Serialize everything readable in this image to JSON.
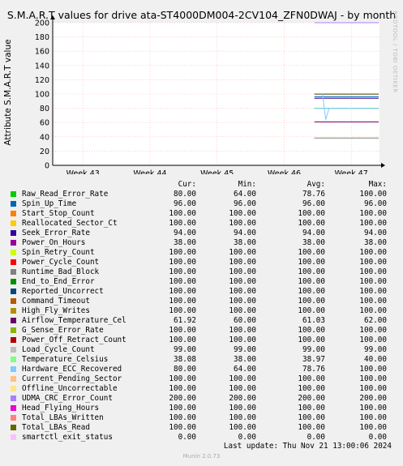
{
  "title": "S.M.A.R.T values for drive ata-ST4000DM004-2CV104_ZFN0DWAJ - by month",
  "watermark": "RRDTOOL / TOBI OETIKER",
  "footer": "Munin 2.0.73",
  "last_update": "Last update: Thu Nov 21 13:00:06 2024",
  "legend_header": {
    "cur": "Cur:",
    "min": "Min:",
    "avg": "Avg:",
    "max": "Max:"
  },
  "chart_data": {
    "type": "line",
    "title": "S.M.A.R.T values for drive ata-ST4000DM004-2CV104_ZFN0DWAJ - by month",
    "ylabel": "Attribute S.M.A.R.T value",
    "xlabel": "",
    "x_ticks": [
      "Week 43",
      "Week 44",
      "Week 45",
      "Week 46",
      "Week 47"
    ],
    "y_ticks": [
      0,
      20,
      40,
      60,
      80,
      100,
      120,
      140,
      160,
      180,
      200
    ],
    "ylim": [
      0,
      200
    ],
    "grid": true,
    "data_start_week": 46.45,
    "series": [
      {
        "name": "Raw_Read_Error_Rate",
        "color": "#00cc00",
        "cur": "80.00",
        "min": "64.00",
        "avg": "78.76",
        "max": "100.00",
        "line": 80
      },
      {
        "name": "Spin_Up_Time",
        "color": "#0066b3",
        "cur": "96.00",
        "min": "96.00",
        "avg": "96.00",
        "max": "96.00",
        "line": 96
      },
      {
        "name": "Start_Stop_Count",
        "color": "#ff8000",
        "cur": "100.00",
        "min": "100.00",
        "avg": "100.00",
        "max": "100.00",
        "line": 100
      },
      {
        "name": "Reallocated_Sector_Ct",
        "color": "#ffcc00",
        "cur": "100.00",
        "min": "100.00",
        "avg": "100.00",
        "max": "100.00",
        "line": 100
      },
      {
        "name": "Seek_Error_Rate",
        "color": "#330099",
        "cur": "94.00",
        "min": "94.00",
        "avg": "94.00",
        "max": "94.00",
        "line": 94
      },
      {
        "name": "Power_On_Hours",
        "color": "#990099",
        "cur": "38.00",
        "min": "38.00",
        "avg": "38.00",
        "max": "38.00",
        "line": 38
      },
      {
        "name": "Spin_Retry_Count",
        "color": "#ccff00",
        "cur": "100.00",
        "min": "100.00",
        "avg": "100.00",
        "max": "100.00",
        "line": 100
      },
      {
        "name": "Power_Cycle_Count",
        "color": "#ff0000",
        "cur": "100.00",
        "min": "100.00",
        "avg": "100.00",
        "max": "100.00",
        "line": 100
      },
      {
        "name": "Runtime_Bad_Block",
        "color": "#808080",
        "cur": "100.00",
        "min": "100.00",
        "avg": "100.00",
        "max": "100.00",
        "line": 100
      },
      {
        "name": "End_to_End_Error",
        "color": "#008f00",
        "cur": "100.00",
        "min": "100.00",
        "avg": "100.00",
        "max": "100.00",
        "line": 100
      },
      {
        "name": "Reported_Uncorrect",
        "color": "#00487d",
        "cur": "100.00",
        "min": "100.00",
        "avg": "100.00",
        "max": "100.00",
        "line": 100
      },
      {
        "name": "Command_Timeout",
        "color": "#b35a00",
        "cur": "100.00",
        "min": "100.00",
        "avg": "100.00",
        "max": "100.00",
        "line": 100
      },
      {
        "name": "High_Fly_Writes",
        "color": "#b38f00",
        "cur": "100.00",
        "min": "100.00",
        "avg": "100.00",
        "max": "100.00",
        "line": 100
      },
      {
        "name": "Airflow_Temperature_Cel",
        "color": "#6b006b",
        "cur": "61.92",
        "min": "60.00",
        "avg": "61.03",
        "max": "62.00",
        "line": 61
      },
      {
        "name": "G_Sense_Error_Rate",
        "color": "#8fb300",
        "cur": "100.00",
        "min": "100.00",
        "avg": "100.00",
        "max": "100.00",
        "line": 100
      },
      {
        "name": "Power_Off_Retract_Count",
        "color": "#b30000",
        "cur": "100.00",
        "min": "100.00",
        "avg": "100.00",
        "max": "100.00",
        "line": 100
      },
      {
        "name": "Load_Cycle_Count",
        "color": "#bebebe",
        "cur": "99.00",
        "min": "99.00",
        "avg": "99.00",
        "max": "99.00",
        "line": 99
      },
      {
        "name": "Temperature_Celsius",
        "color": "#80ff80",
        "cur": "38.08",
        "min": "38.00",
        "avg": "38.97",
        "max": "40.00",
        "line": 38.5
      },
      {
        "name": "Hardware_ECC_Recovered",
        "color": "#80c9ff",
        "cur": "80.00",
        "min": "64.00",
        "avg": "78.76",
        "max": "100.00",
        "line": 80
      },
      {
        "name": "Current_Pending_Sector",
        "color": "#ffc080",
        "cur": "100.00",
        "min": "100.00",
        "avg": "100.00",
        "max": "100.00",
        "line": 100
      },
      {
        "name": "Offline_Uncorrectable",
        "color": "#ffe680",
        "cur": "100.00",
        "min": "100.00",
        "avg": "100.00",
        "max": "100.00",
        "line": 100
      },
      {
        "name": "UDMA_CRC_Error_Count",
        "color": "#aa80ff",
        "cur": "200.00",
        "min": "200.00",
        "avg": "200.00",
        "max": "200.00",
        "line": 200
      },
      {
        "name": "Head_Flying_Hours",
        "color": "#ee00cc",
        "cur": "100.00",
        "min": "100.00",
        "avg": "100.00",
        "max": "100.00",
        "line": 100
      },
      {
        "name": "Total_LBAs_Written",
        "color": "#ff8080",
        "cur": "100.00",
        "min": "100.00",
        "avg": "100.00",
        "max": "100.00",
        "line": 100
      },
      {
        "name": "Total_LBAs_Read",
        "color": "#666600",
        "cur": "100.00",
        "min": "100.00",
        "avg": "100.00",
        "max": "100.00",
        "line": 100
      },
      {
        "name": "smartctl_exit_status",
        "color": "#ffbfff",
        "cur": "0.00",
        "min": "0.00",
        "avg": "0.00",
        "max": "0.00",
        "line": 0
      }
    ]
  }
}
